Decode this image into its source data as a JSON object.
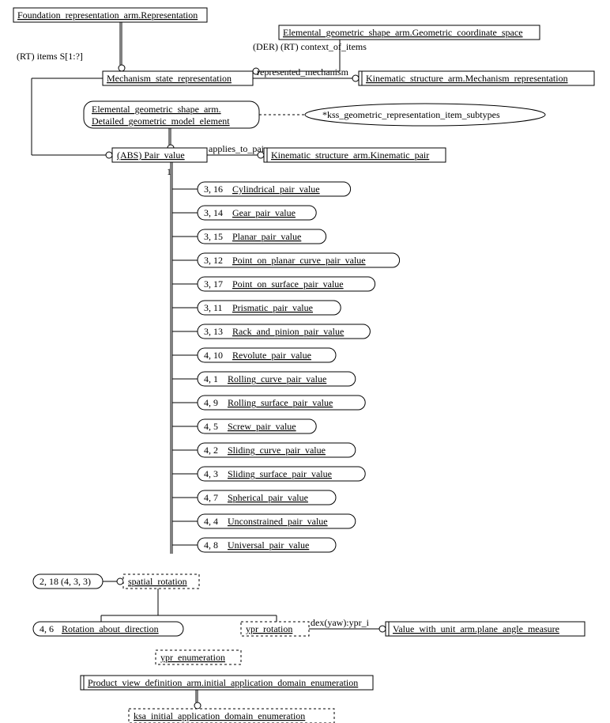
{
  "nodes": {
    "foundation": "Foundation_representation_arm.Representation",
    "elemental_coord": "Elemental_geometric_shape_arm.Geometric_coordinate_space",
    "mech_state": "Mechanism_state_representation",
    "kin_mech": "Kinematic_structure_arm.Mechanism_representation",
    "elemental_detail_l1": "Elemental_geometric_shape_arm.",
    "elemental_detail_l2": "Detailed_geometric_model_element",
    "kss_subtypes": "*kss_geometric_representation_item_subtypes",
    "pair_value": "(ABS) Pair_value",
    "kin_pair": "Kinematic_structure_arm.Kinematic_pair",
    "spatial_rotation": "spatial_rotation",
    "rotation_about": "Rotation_about_direction",
    "ypr_rotation": "ypr_rotation",
    "plane_angle": "Value_with_unit_arm.plane_angle_measure",
    "ypr_enum": "ypr_enumeration",
    "product_view": "Product_view_definition_arm.initial_application_domain_enumeration",
    "ksa_enum": "ksa_initial_application_domain_enumeration"
  },
  "edges": {
    "rt_items": "(RT) items S[1:?]",
    "der_rt_context": "(DER) (RT) context_of_items",
    "represented_mech": "represented_mechanism",
    "applies_to_pair": "applies_to_pair",
    "one": "1",
    "dex_yaw": "dex(yaw):ypr_i",
    "page_218": "2, 18 (4, 3, 3)"
  },
  "pair_values": [
    {
      "pg": "3, 16",
      "name": "Cylindrical_pair_value"
    },
    {
      "pg": "3, 14",
      "name": "Gear_pair_value"
    },
    {
      "pg": "3, 15",
      "name": "Planar_pair_value"
    },
    {
      "pg": "3, 12",
      "name": "Point_on_planar_curve_pair_value"
    },
    {
      "pg": "3, 17",
      "name": "Point_on_surface_pair_value"
    },
    {
      "pg": "3, 11",
      "name": "Prismatic_pair_value"
    },
    {
      "pg": "3, 13",
      "name": "Rack_and_pinion_pair_value"
    },
    {
      "pg": "4, 10",
      "name": "Revolute_pair_value"
    },
    {
      "pg": "4, 1",
      "name": "Rolling_curve_pair_value"
    },
    {
      "pg": "4, 9",
      "name": "Rolling_surface_pair_value"
    },
    {
      "pg": "4, 5",
      "name": "Screw_pair_value"
    },
    {
      "pg": "4, 2",
      "name": "Sliding_curve_pair_value"
    },
    {
      "pg": "4, 3",
      "name": "Sliding_surface_pair_value"
    },
    {
      "pg": "4, 7",
      "name": "Spherical_pair_value"
    },
    {
      "pg": "4, 4",
      "name": "Unconstrained_pair_value"
    },
    {
      "pg": "4, 8",
      "name": "Universal_pair_value"
    }
  ],
  "rotation_pg": "4, 6"
}
